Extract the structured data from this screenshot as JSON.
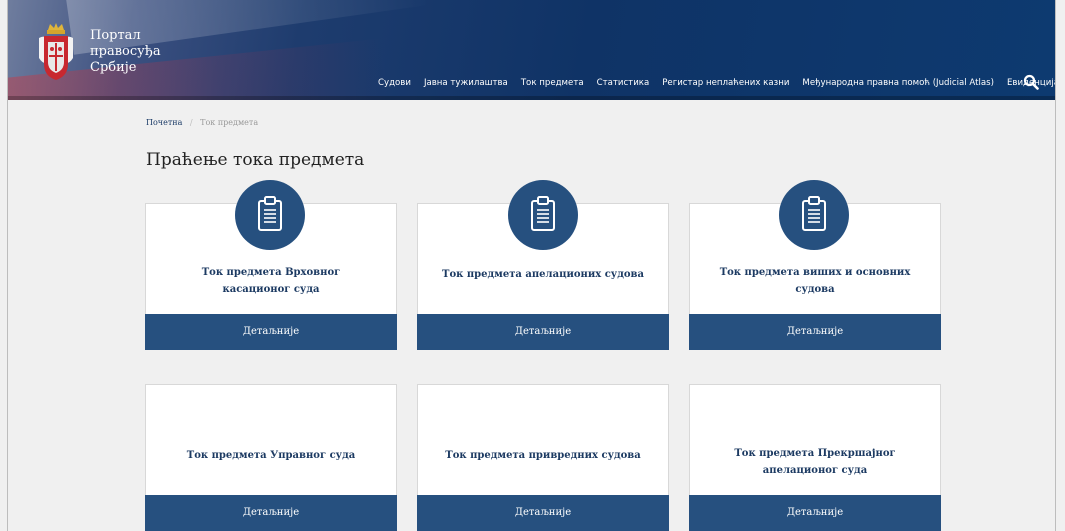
{
  "brand": {
    "line1": "Портал",
    "line2": "правосуђа",
    "line3": "Србије"
  },
  "nav": {
    "items": [
      "Судови",
      "Јавна тужилаштва",
      "Ток предмета",
      "Статистика",
      "Регистар неплаћених казни",
      "Међународна правна помоћ (Judicial Atlas)",
      "Евиденција"
    ]
  },
  "breadcrumb": {
    "home": "Почетна",
    "separator": "/",
    "current": "Ток предмета"
  },
  "page_title": "Праћење тока предмета",
  "cards": [
    {
      "title_line1": "Ток предмета Врховног",
      "title_line2": "касационог суда",
      "button": "Детаљније"
    },
    {
      "title_line1": "Ток предмета апелационих судова",
      "title_line2": "",
      "button": "Детаљније"
    },
    {
      "title_line1": "Ток предмета виших и основних",
      "title_line2": "судова",
      "button": "Детаљније"
    },
    {
      "title_line1": "Ток предмета Управног суда",
      "title_line2": "",
      "button": "Детаљније"
    },
    {
      "title_line1": "Ток предмета привредних судова",
      "title_line2": "",
      "button": "Детаљније"
    },
    {
      "title_line1": "Ток предмета Прекршајног",
      "title_line2": "апелационог суда",
      "button": "Детаљније"
    }
  ],
  "icons": {
    "crest": "serbia-coat-of-arms-icon",
    "search": "search-icon",
    "document": "clipboard-document-icon"
  },
  "colors": {
    "header": "#0f3366",
    "accent": "#26507f",
    "title_text": "#1c3a62"
  }
}
